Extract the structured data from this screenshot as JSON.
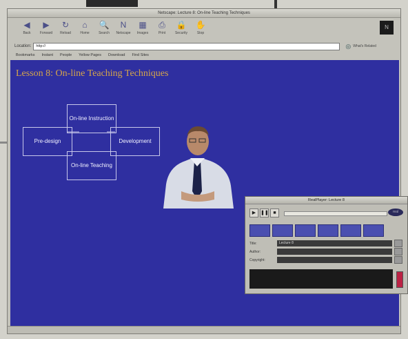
{
  "window_title": "Netscape: Lecture 8: On-line Teaching Techniques",
  "toolbar": [
    {
      "label": "Back",
      "icon": "back-arrow-icon",
      "glyph": "◀"
    },
    {
      "label": "Forward",
      "icon": "forward-arrow-icon",
      "glyph": "▶"
    },
    {
      "label": "Reload",
      "icon": "reload-icon",
      "glyph": "↻"
    },
    {
      "label": "Home",
      "icon": "home-icon",
      "glyph": "⌂"
    },
    {
      "label": "Search",
      "icon": "search-icon",
      "glyph": "🔍"
    },
    {
      "label": "Netscape",
      "icon": "netscape-icon",
      "glyph": "N"
    },
    {
      "label": "Images",
      "icon": "images-icon",
      "glyph": "▦"
    },
    {
      "label": "Print",
      "icon": "print-icon",
      "glyph": "⎙"
    },
    {
      "label": "Security",
      "icon": "security-icon",
      "glyph": "🔒"
    },
    {
      "label": "Stop",
      "icon": "stop-icon",
      "glyph": "✋"
    }
  ],
  "location": {
    "label": "Location:",
    "value": "http://"
  },
  "whats_related_label": "What's Related",
  "bookmarks": [
    "Bookmarks",
    "Instant",
    "People",
    "Yellow Pages",
    "Download",
    "Find Sites"
  ],
  "page": {
    "title": "Lesson 8: On-line Teaching Techniques",
    "diagram_boxes": [
      {
        "id": "online-instruction",
        "label": "On-line Instruction"
      },
      {
        "id": "pre-design",
        "label": "Pre-design"
      },
      {
        "id": "development",
        "label": "Development"
      },
      {
        "id": "online-teaching",
        "label": "On-line Teaching"
      }
    ]
  },
  "realplayer": {
    "title": "RealPlayer: Lecture 8",
    "tabs": [
      "",
      "",
      "",
      "",
      "",
      ""
    ],
    "info": [
      {
        "key": "Title:",
        "value": "Lecture 8"
      },
      {
        "key": "Author:",
        "value": ""
      },
      {
        "key": "Copyright:",
        "value": ""
      }
    ],
    "screen_text": ""
  },
  "colors": {
    "page_background": "#2f2fa0",
    "title_color": "#d6a54a",
    "diagram_line": "#c8c8ea"
  }
}
